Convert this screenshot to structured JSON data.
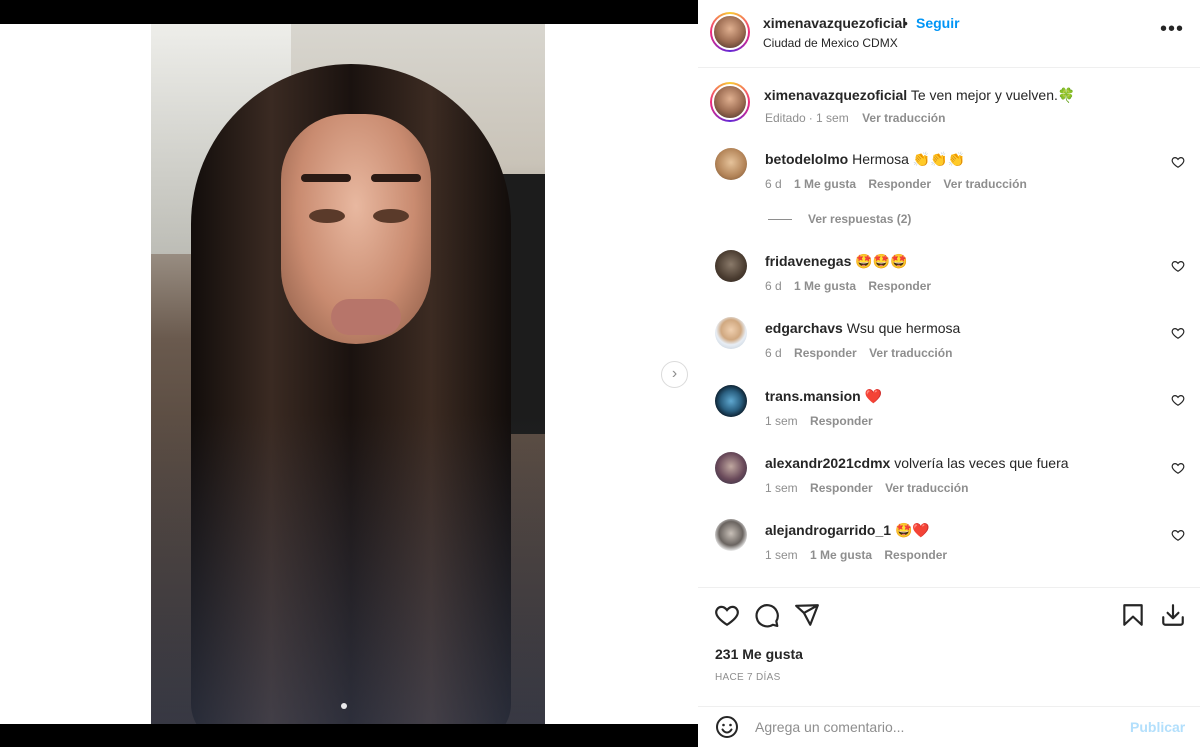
{
  "post": {
    "username": "ximenavazquezoficial",
    "follow_label": "Seguir",
    "separator": "•",
    "location": "Ciudad de Mexico CDMX",
    "caption_text": "Te ven mejor y vuelven.🍀",
    "caption_edited": "Editado",
    "caption_time": "1 sem",
    "translate_label": "Ver traducción",
    "likes": "231 Me gusta",
    "posted": "HACE 7 DÍAS"
  },
  "comments": [
    {
      "user": "betodelolmo",
      "text": "Hermosa 👏👏👏",
      "time": "6 d",
      "likes": "1 Me gusta",
      "reply": "Responder",
      "translate": "Ver traducción"
    },
    {
      "user": "fridavenegas",
      "text": "🤩🤩🤩",
      "time": "6 d",
      "likes": "1 Me gusta",
      "reply": "Responder",
      "translate": ""
    },
    {
      "user": "edgarchavs",
      "text": "Wsu que hermosa",
      "time": "6 d",
      "likes": "",
      "reply": "Responder",
      "translate": "Ver traducción"
    },
    {
      "user": "trans.mansion",
      "text": "❤️",
      "time": "1 sem",
      "likes": "",
      "reply": "Responder",
      "translate": ""
    },
    {
      "user": "alexandr2021cdmx",
      "text": "volvería las veces que fuera",
      "time": "1 sem",
      "likes": "",
      "reply": "Responder",
      "translate": "Ver traducción"
    },
    {
      "user": "alejandrogarrido_1",
      "text": "🤩❤️",
      "time": "1 sem",
      "likes": "1 Me gusta",
      "reply": "Responder",
      "translate": ""
    }
  ],
  "replies_label": "Ver respuestas (2)",
  "add_comment": {
    "placeholder": "Agrega un comentario...",
    "publish_label": "Publicar"
  },
  "icons": {
    "next": "chevron-right-icon",
    "more": "more-options-icon",
    "like": "heart-icon",
    "comment": "comment-icon",
    "share": "share-icon",
    "save": "bookmark-icon",
    "download": "download-icon",
    "emoji": "emoji-icon"
  },
  "colors": {
    "accent": "#0095f6",
    "publish_disabled": "#b2dffc",
    "secondary_text": "#8e8e8e"
  }
}
